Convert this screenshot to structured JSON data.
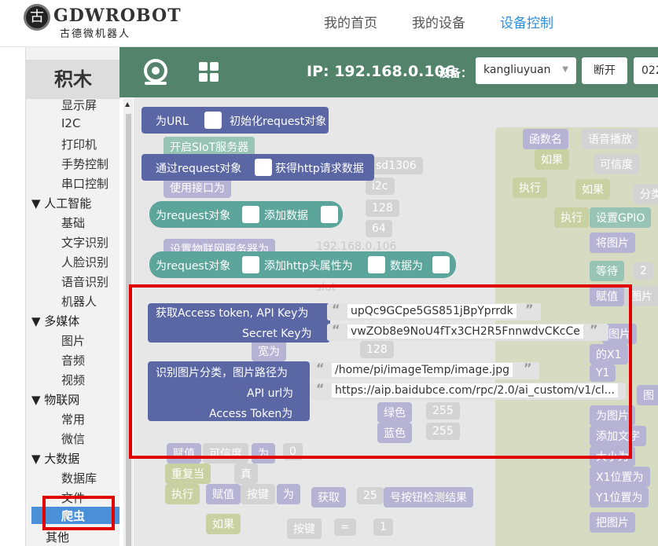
{
  "header": {
    "logo_glyph": "古",
    "logo_en": "GDWROBOT",
    "logo_cn": "古德微机器人",
    "nav": [
      "我的首页",
      "我的设备",
      "设备控制"
    ],
    "active_nav": "设备控制"
  },
  "sidebar": {
    "title": "积木",
    "items": [
      {
        "label": "显示屏",
        "type": "item"
      },
      {
        "label": "I2C",
        "type": "item"
      },
      {
        "label": "打印机",
        "type": "item"
      },
      {
        "label": "手势控制",
        "type": "item"
      },
      {
        "label": "串口控制",
        "type": "item"
      },
      {
        "label": "▼ 人工智能",
        "type": "category"
      },
      {
        "label": "基础",
        "type": "item"
      },
      {
        "label": "文字识别",
        "type": "item"
      },
      {
        "label": "人脸识别",
        "type": "item"
      },
      {
        "label": "语音识别",
        "type": "item"
      },
      {
        "label": "机器人",
        "type": "item"
      },
      {
        "label": "▼ 多媒体",
        "type": "category"
      },
      {
        "label": "图片",
        "type": "item"
      },
      {
        "label": "音频",
        "type": "item"
      },
      {
        "label": "视频",
        "type": "item"
      },
      {
        "label": "▼ 物联网",
        "type": "category"
      },
      {
        "label": "常用",
        "type": "item"
      },
      {
        "label": "微信",
        "type": "item"
      },
      {
        "label": "▼ 大数据",
        "type": "category"
      },
      {
        "label": "数据库",
        "type": "item"
      },
      {
        "label": "文件",
        "type": "item"
      },
      {
        "label": "爬虫",
        "type": "selected"
      },
      {
        "label": "其他",
        "type": "category"
      }
    ]
  },
  "toolbar": {
    "ip_label": "IP: 192.168.0.106",
    "device_label": "设备：",
    "device_value": "kangliuyuan",
    "disconnect": "断开",
    "extra": "022"
  },
  "blocks": {
    "b1": {
      "a": "为URL",
      "b": "初始化request对象"
    },
    "b2": {
      "a": "通过request对象",
      "b": "获得http请求数据"
    },
    "b3": {
      "a": "为request对象",
      "b": "添加数据"
    },
    "b4": {
      "a": "为request对象",
      "b": "添加http头属性为",
      "c": "数据为"
    },
    "b5": {
      "a": "获取Access token, API Key为",
      "api_key": "upQc9GCpe5GS851jBpYprrdk",
      "b": "Secret Key为",
      "secret_key": "vwZOb8e9NoU4fTx3CH2R5FnnwdvCKcCe"
    },
    "b6": {
      "a": "识别图片分类，图片路径为",
      "path": "/home/pi/imageTemp/image.jpg",
      "b": "API url为",
      "url": "https://aip.baidubce.com/rpc/2.0/ai_custom/v1/cl...",
      "c": "Access Token为"
    }
  },
  "ghost": {
    "t1": "开启SIoT服务器",
    "t2": "使用接口为",
    "t3": "设置物联网服务器为",
    "t4": "192.168.0.106",
    "t5": "sd1306",
    "t6": "i2c",
    "t7": "128",
    "t8": "64",
    "t9": "slot",
    "t10": "宽为",
    "t11": "128",
    "t12": "绿色",
    "t13": "255",
    "t14": "蓝色",
    "t15": "255",
    "t16": "赋值",
    "t17": "可信度",
    "t18": "为",
    "t19": "0",
    "t20": "重复当",
    "t21": "真",
    "t22": "执行",
    "t23": "赋值",
    "t24": "按键",
    "t25": "为",
    "t26": "获取",
    "t27": "25",
    "t28": "号按钮检测结果",
    "t29": "如果",
    "t30": "按键",
    "t31": "=",
    "t32": "1",
    "r1": "函数名",
    "r2": "语音播放",
    "r3": "如果",
    "r4": "可信度",
    "r5": "执行",
    "r6": "如果",
    "r7": "分类",
    "r8": "执行",
    "r9": "设置GPIO",
    "r10": "将图片",
    "r11": "等待",
    "r12": "2",
    "r13": "赋值",
    "r14": "图片",
    "r15": "图片",
    "r16": "的X1",
    "r17": "Y1",
    "r18": "图",
    "r19": "为图片",
    "r20": "添加文字",
    "r21": "大小为",
    "r22": "X1位置为",
    "r23": "Y1位置为",
    "r24": "把图片"
  },
  "colors": {
    "toolbar": "#53836b",
    "block_purple": "#5b67a5",
    "block_teal": "#5ba59a",
    "highlight": "#e00000",
    "nav_active": "#2f8fdc"
  }
}
